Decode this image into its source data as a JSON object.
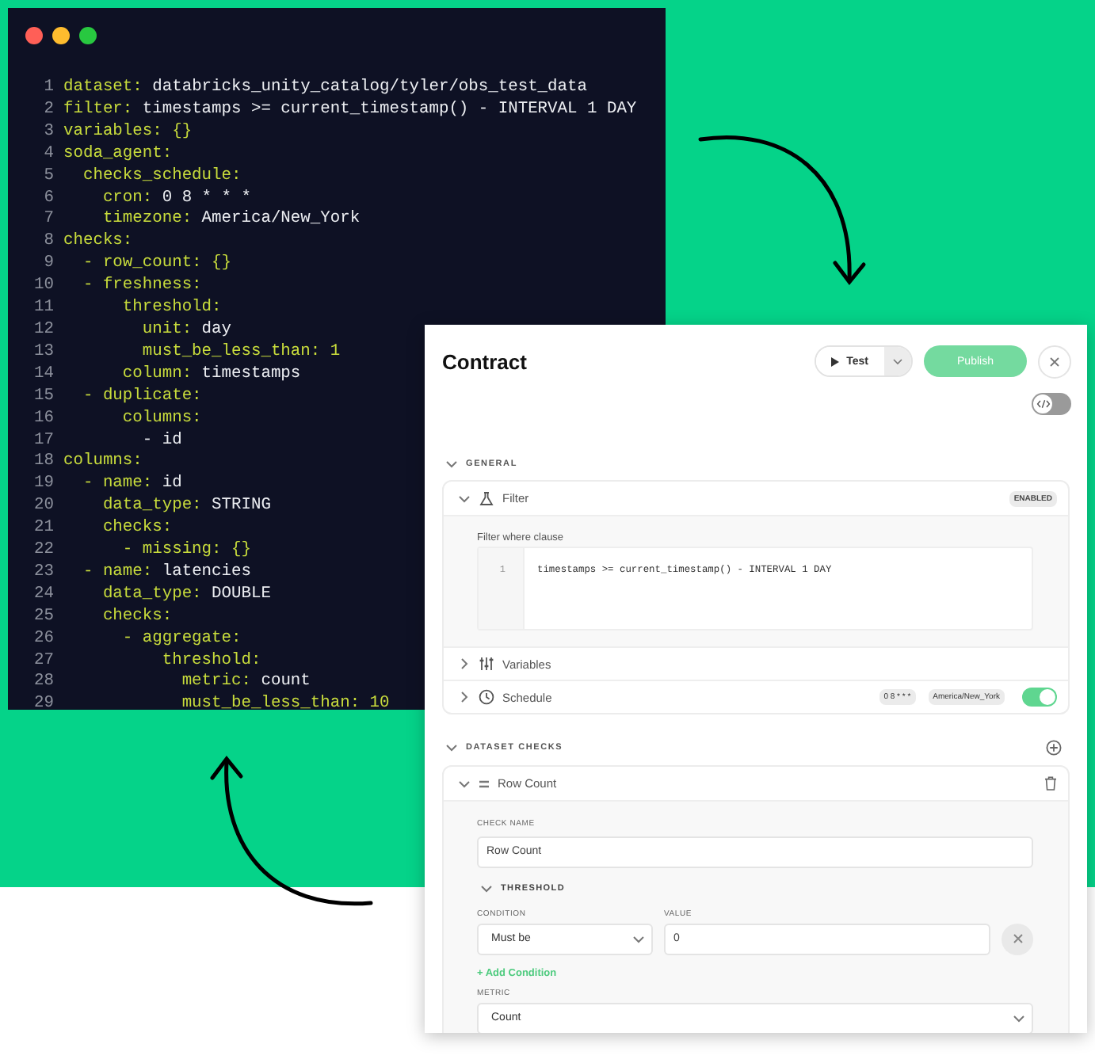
{
  "editor": {
    "lines": [
      {
        "number": "1",
        "key": "dataset:",
        "value": "databricks_unity_catalog/tyler/obs_test_data"
      },
      {
        "number": "2",
        "key": "filter:",
        "value": "timestamps >= current_timestamp() - INTERVAL 1 DAY"
      },
      {
        "number": "3",
        "key": "variables: {}"
      },
      {
        "number": "4",
        "key": "soda_agent:"
      },
      {
        "number": "5",
        "key": "  checks_schedule:"
      },
      {
        "number": "6",
        "key": "    cron:",
        "value": "0 8 * * *"
      },
      {
        "number": "7",
        "key": "    timezone:",
        "value": "America/New_York"
      },
      {
        "number": "8",
        "key": "checks:"
      },
      {
        "number": "9",
        "key": "  - row_count: {}"
      },
      {
        "number": "10",
        "key": "  - freshness:"
      },
      {
        "number": "11",
        "key": "      threshold:"
      },
      {
        "number": "12",
        "key": "        unit:",
        "value": "day"
      },
      {
        "number": "13",
        "key": "        must_be_less_than: 1"
      },
      {
        "number": "14",
        "key": "      column:",
        "value": "timestamps"
      },
      {
        "number": "15",
        "key": "  - duplicate:"
      },
      {
        "number": "16",
        "key": "      columns:"
      },
      {
        "number": "17",
        "value": "        - id"
      },
      {
        "number": "18",
        "key": "columns:"
      },
      {
        "number": "19",
        "key": "  - name:",
        "value": "id"
      },
      {
        "number": "20",
        "key": "    data_type:",
        "value": "STRING"
      },
      {
        "number": "21",
        "key": "    checks:"
      },
      {
        "number": "22",
        "key": "      - missing: {}"
      },
      {
        "number": "23",
        "key": "  - name:",
        "value": "latencies"
      },
      {
        "number": "24",
        "key": "    data_type:",
        "value": "DOUBLE"
      },
      {
        "number": "25",
        "key": "    checks:"
      },
      {
        "number": "26",
        "key": "      - aggregate:"
      },
      {
        "number": "27",
        "key": "          threshold:"
      },
      {
        "number": "28",
        "key": "            metric:",
        "value": "count"
      },
      {
        "number": "29",
        "key": "            must_be_less_than: 10"
      }
    ]
  },
  "contract": {
    "title": "Contract",
    "test_button": "Test",
    "publish_button": "Publish",
    "code_view_toggle": {
      "on": false
    },
    "general": {
      "title": "GENERAL",
      "expanded": true,
      "sections": [
        {
          "kind": "filter",
          "label": "Filter",
          "expanded": true,
          "badge": "ENABLED",
          "field_label": "Filter where clause",
          "code_lines": [
            {
              "number": "1",
              "text": "timestamps >= current_timestamp() - INTERVAL 1 DAY"
            }
          ]
        },
        {
          "kind": "variables",
          "label": "Variables",
          "expanded": false
        },
        {
          "kind": "schedule",
          "label": "Schedule",
          "expanded": false,
          "badges": [
            "0 8 * * *",
            "America/New_York"
          ],
          "enabled": true
        }
      ]
    },
    "dataset_checks": {
      "title": "DATASET CHECKS",
      "expanded": true,
      "checks": [
        {
          "name": "Row Count",
          "expanded": true,
          "check_name_label": "CHECK NAME",
          "check_name_value": "Row Count",
          "threshold": {
            "title": "THRESHOLD",
            "expanded": true,
            "condition_label": "CONDITION",
            "condition_value": "Must be",
            "value_label": "VALUE",
            "value": "0"
          },
          "add_condition": "+ Add Condition",
          "metric_label": "METRIC",
          "metric_value": "Count"
        }
      ]
    }
  }
}
